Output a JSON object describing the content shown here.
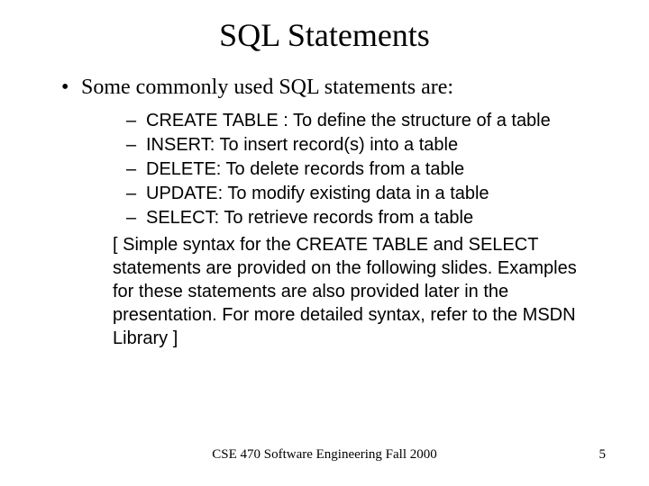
{
  "title": "SQL Statements",
  "intro": "Some commonly used SQL statements are:",
  "items": [
    "CREATE TABLE : To define the structure of a table",
    "INSERT: To insert record(s) into a table",
    "DELETE: To delete records from a table",
    "UPDATE: To modify existing data in a table",
    "SELECT: To retrieve records from a table"
  ],
  "note": "[ Simple syntax for the CREATE TABLE and SELECT statements are provided on the following slides.  Examples for these statements are also provided later in the presentation.  For more detailed syntax, refer to the MSDN Library ]",
  "footer": {
    "course": "CSE 470   Software Engineering    Fall 2000",
    "page": "5"
  }
}
